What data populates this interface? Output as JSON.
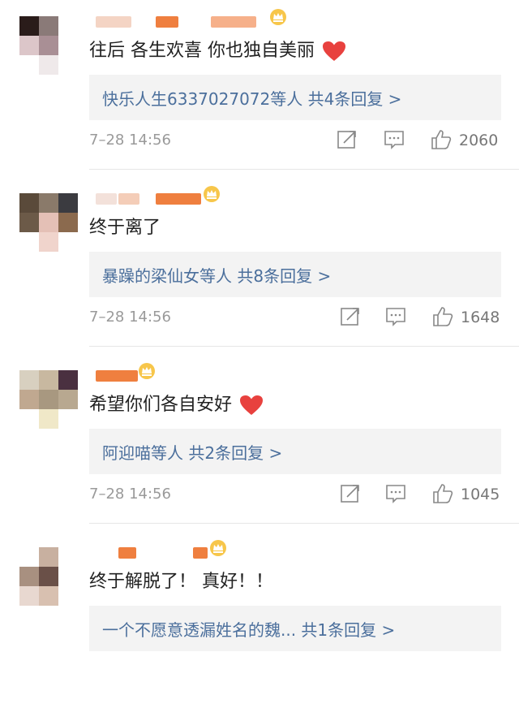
{
  "comments": [
    {
      "text": "往后 各生欢喜 你也独自美丽",
      "has_heart": true,
      "reply_summary": "快乐人生6337027072等人  共4条回复 >",
      "time": "7–28 14:56",
      "likes": "2060"
    },
    {
      "text": "终于离了",
      "has_heart": false,
      "reply_summary": "暴躁的梁仙女等人  共8条回复 >",
      "time": "7–28 14:56",
      "likes": "1648"
    },
    {
      "text": "希望你们各自安好",
      "has_heart": true,
      "reply_summary": "阿迎喵等人  共2条回复 >",
      "time": "7–28 14:56",
      "likes": "1045"
    },
    {
      "text": "终于解脱了！ 真好！！",
      "has_heart": false,
      "reply_summary": "一个不愿意透漏姓名的魏...  共1条回复 >",
      "time": "",
      "likes": ""
    }
  ],
  "colors": {
    "link": "#4b6f9c",
    "heart": "#e8413e",
    "crown": "#f0a020",
    "name_blur": "#f08a4b"
  },
  "icons": [
    "share-icon",
    "comment-icon",
    "like-icon",
    "crown-badge-icon",
    "heart-icon"
  ]
}
